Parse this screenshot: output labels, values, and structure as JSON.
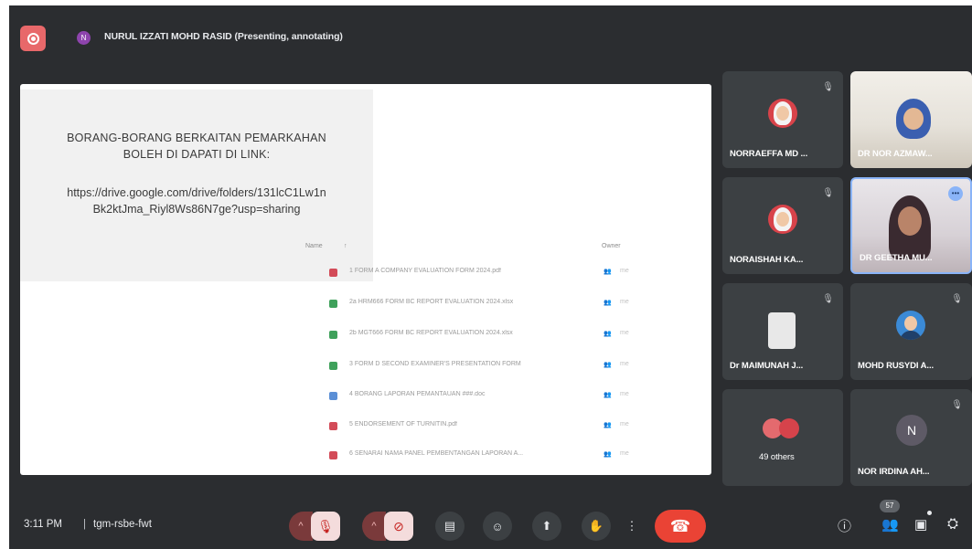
{
  "meeting": {
    "presenter_initial": "N",
    "presenter_label": "NURUL IZZATI MOHD RASID (Presenting, annotating)",
    "time": "3:11 PM",
    "separator": "|",
    "code": "tgm-rsbe-fwt",
    "participant_count": "57"
  },
  "shared_screen": {
    "note_title": "BORANG-BORANG BERKAITAN PEMARKAHAN\nBOLEH DI DAPATI DI LINK:",
    "note_link": "https://drive.google.com/drive/folders/131lcC1Lw1n\nBk2ktJma_Riyl8Ws86N7ge?usp=sharing",
    "drive": {
      "col_name": "Name",
      "col_sort": "↑",
      "col_owner": "Owner",
      "files": [
        {
          "name": "1 FORM A COMPANY EVALUATION FORM 2024.pdf",
          "type": "pdf",
          "share": "👥",
          "owner": "me"
        },
        {
          "name": "2a HRM666 FORM BC REPORT EVALUATION 2024.xlsx",
          "type": "sheet",
          "share": "👥",
          "owner": "me"
        },
        {
          "name": "2b MGT666 FORM BC REPORT EVALUATION 2024.xlsx",
          "type": "sheet",
          "share": "👥",
          "owner": "me"
        },
        {
          "name": "3 FORM D SECOND EXAMINER'S PRESENTATION FORM",
          "type": "sheet",
          "share": "👥",
          "owner": "me"
        },
        {
          "name": "4 BORANG LAPORAN PEMANTAUAN ###.doc",
          "type": "doc",
          "share": "👥",
          "owner": "me"
        },
        {
          "name": "5 ENDORSEMENT OF TURNITIN.pdf",
          "type": "pdf",
          "share": "👥",
          "owner": "me"
        },
        {
          "name": "6 SENARAI NAMA PANEL PEMBENTANGAN LAPORAN A...",
          "type": "pdf",
          "share": "👥",
          "owner": "me"
        }
      ]
    }
  },
  "participants": [
    {
      "name": "NORRAEFFA MD ...",
      "style": "avatar-red",
      "muted": true
    },
    {
      "name": "DR NOR AZMAW...",
      "style": "photo",
      "muted": false
    },
    {
      "name": "NORAISHAH KA...",
      "style": "avatar-red",
      "muted": true
    },
    {
      "name": "DR GEETHA MU...",
      "style": "photo-speaking",
      "muted": false
    },
    {
      "name": "Dr MAIMUNAH J...",
      "style": "avatar-plain",
      "muted": true
    },
    {
      "name": "MOHD RUSYDI A...",
      "style": "avatar-blue",
      "muted": true
    },
    {
      "name": "49 others",
      "style": "group",
      "muted": false
    },
    {
      "name": "NOR IRDINA AH...",
      "style": "initial",
      "initial": "N",
      "muted": true
    }
  ],
  "icons": {
    "mic_off": "🎙",
    "cam_off": "⊘",
    "captions": "▤",
    "emoji": "☺",
    "present": "⬆",
    "hand": "✋",
    "more": "⋮",
    "end_call": "☎",
    "info": "ⓘ",
    "people": "👥",
    "chat": "▣",
    "activities": "⛭",
    "chevron_up": "^"
  },
  "colors": {
    "meet_bg": "#2b2d30",
    "tile_bg": "#3c4043",
    "end_call_red": "#ea4335",
    "record_red": "#e8686a"
  }
}
